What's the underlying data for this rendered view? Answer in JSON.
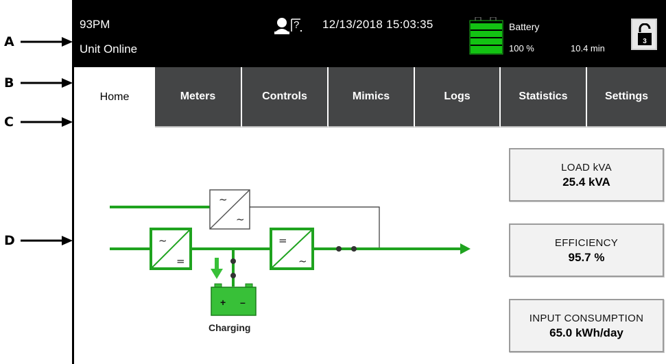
{
  "callouts": [
    "A",
    "B",
    "C",
    "D"
  ],
  "status_bar": {
    "model": "93PM",
    "unit_status": "Unit Online",
    "user_icon": "user-level-icon",
    "datetime": "12/13/2018 15:03:35",
    "battery_label": "Battery",
    "battery_percent": "100 %",
    "battery_time": "10.4 min",
    "battery_level": 1.0,
    "lock_icon": "unlocked-padlock-icon",
    "lock_level": "3"
  },
  "tabs": [
    {
      "label": "Home",
      "active": true
    },
    {
      "label": "Meters",
      "active": false
    },
    {
      "label": "Controls",
      "active": false
    },
    {
      "label": "Mimics",
      "active": false
    },
    {
      "label": "Logs",
      "active": false
    },
    {
      "label": "Statistics",
      "active": false
    },
    {
      "label": "Settings",
      "active": false
    }
  ],
  "mimic": {
    "battery_status": "Charging",
    "battery_icon": "battery-icon",
    "rectifier_icon": "ac-dc-converter-icon",
    "inverter_icon": "dc-ac-converter-icon",
    "bypass_icon": "ac-ac-converter-icon"
  },
  "info": {
    "load_label": "LOAD kVA",
    "load_value": "25.4 kVA",
    "efficiency_label": "EFFICIENCY",
    "efficiency_value": "95.7 %",
    "consumption_label": "INPUT CONSUMPTION",
    "consumption_value": "65.0 kWh/day"
  },
  "colors": {
    "flow_green": "#1fa31f",
    "battery_green": "#38c038",
    "tab_dark": "#444546",
    "status_bar": "#000000"
  }
}
